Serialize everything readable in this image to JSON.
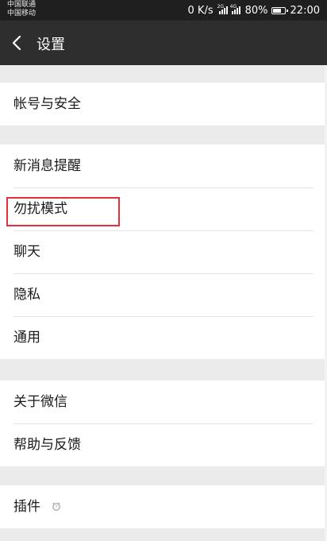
{
  "status_bar": {
    "carrier_1": "中国联通",
    "carrier_2": "中国移动",
    "net_speed": "0 K/s",
    "sig1_tag": "2G",
    "sig2_tag": "4G",
    "battery": "80%",
    "battery_level": 0.8,
    "time": "22:00"
  },
  "header": {
    "title": "设置"
  },
  "menu": {
    "account_security": "帐号与安全",
    "new_message_alerts": "新消息提醒",
    "do_not_disturb": "勿扰模式",
    "chat": "聊天",
    "privacy": "隐私",
    "general": "通用",
    "about_wechat": "关于微信",
    "help_feedback": "帮助与反馈",
    "plugins": "插件"
  },
  "colors": {
    "highlight": "#e0323a",
    "titlebar": "#2e2e2e",
    "statusbar": "#1f1f1f"
  }
}
